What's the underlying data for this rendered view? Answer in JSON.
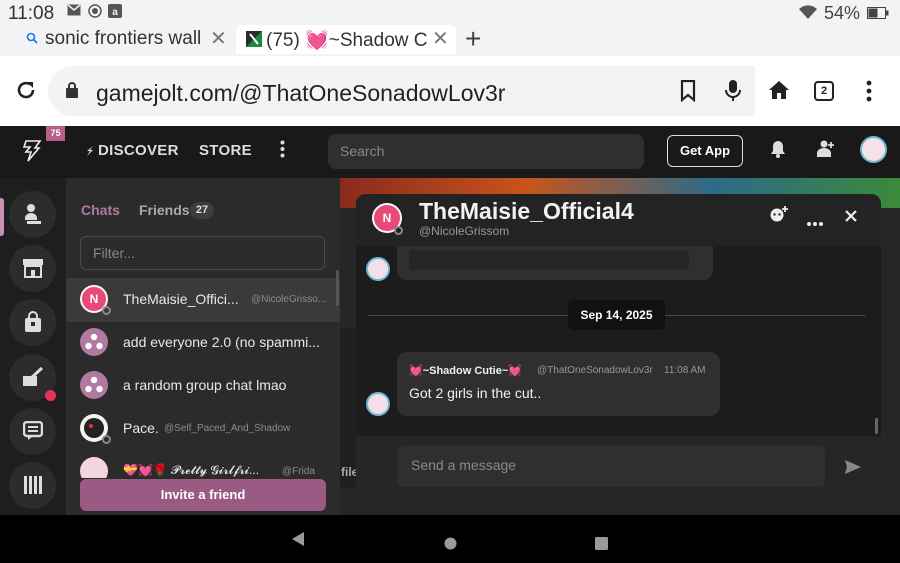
{
  "status_bar": {
    "time": "11:08",
    "battery": "54%",
    "icons": [
      "mail-icon",
      "record-icon",
      "amazon-icon",
      "wifi-icon",
      "battery-icon"
    ]
  },
  "browser": {
    "tabs": [
      {
        "label": "sonic frontiers wall",
        "icon": "search-icon"
      },
      {
        "label": "(75) 💓~Shadow C",
        "icon": "gamejolt-favicon"
      }
    ],
    "url": "gamejolt.com/@ThatOneSonadowLov3r",
    "tab_count": "2"
  },
  "gamejolt_nav": {
    "notification_count": "75",
    "discover": "DISCOVER",
    "store": "STORE",
    "search_placeholder": "Search",
    "get_app": "Get App"
  },
  "chat_list": {
    "tab_chats": "Chats",
    "tab_friends": "Friends",
    "friends_count": "27",
    "filter_placeholder": "Filter...",
    "items": [
      {
        "name": "TheMaisie_Offici...",
        "handle": "@NicoleGrisso..."
      },
      {
        "name": "add everyone 2.0 (no spammi...",
        "handle": ""
      },
      {
        "name": "a random group chat lmao",
        "handle": ""
      },
      {
        "name": "Pace.",
        "handle": "@Self_Paced_And_Shadow"
      },
      {
        "name": "💝💓🌹 𝓟𝓻𝓮𝓽𝓽𝔂 𝓖𝓲𝓻𝓵𝓯𝓻𝓲...",
        "handle": "@Frida"
      }
    ],
    "invite_button": "Invite a friend"
  },
  "background_page": {
    "partial_text": "file"
  },
  "chat_window": {
    "title": "TheMaisie_Official4",
    "subtitle": "@NicoleGrissom",
    "date_divider": "Sep 14, 2025",
    "message": {
      "author": "💓~Shadow Cutie~💓",
      "handle": "@ThatOneSonadowLov3r",
      "time": "11:08 AM",
      "text": "Got 2 girls in the cut.."
    },
    "input_placeholder": "Send a message"
  },
  "colors": {
    "accent_pink": "#9a5a83",
    "chats_tab": "#b07aa0",
    "notification_dot": "#e8305a"
  }
}
